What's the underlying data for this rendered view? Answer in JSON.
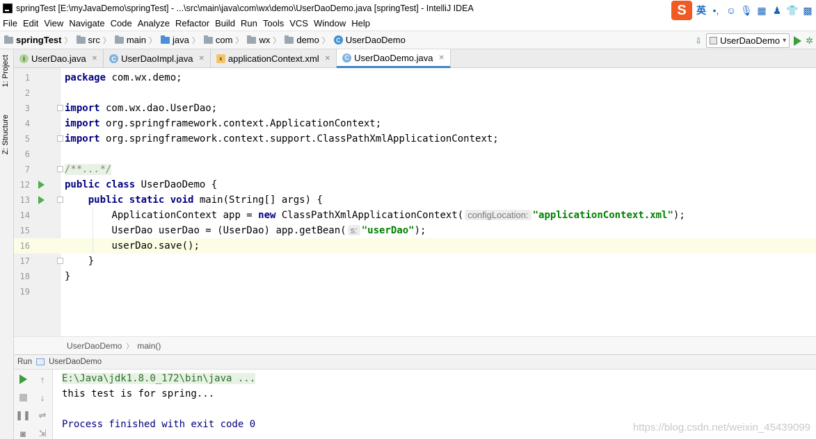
{
  "window": {
    "title": "springTest [E:\\myJavaDemo\\springTest] - ...\\src\\main\\java\\com\\wx\\demo\\UserDaoDemo.java [springTest] - IntelliJ IDEA"
  },
  "ime": {
    "logo": "S",
    "mode": "英"
  },
  "menu": [
    "File",
    "Edit",
    "View",
    "Navigate",
    "Code",
    "Analyze",
    "Refactor",
    "Build",
    "Run",
    "Tools",
    "VCS",
    "Window",
    "Help"
  ],
  "breadcrumbs": {
    "project": "springTest",
    "src": "src",
    "main": "main",
    "java": "java",
    "com": "com",
    "wx": "wx",
    "demo": "demo",
    "file": "UserDaoDemo"
  },
  "run_config": {
    "label": "UserDaoDemo"
  },
  "tool_windows": {
    "project": "1: Project",
    "structure": "Z: Structure"
  },
  "tabs": [
    {
      "label": "UserDao.java",
      "icon": "interface-icon",
      "icon_letter": "I"
    },
    {
      "label": "UserDaoImpl.java",
      "icon": "class-icon",
      "icon_letter": "C"
    },
    {
      "label": "applicationContext.xml",
      "icon": "xml-file-icon",
      "icon_letter": "x"
    },
    {
      "label": "UserDaoDemo.java",
      "icon": "class-icon",
      "icon_letter": "C",
      "active": true
    }
  ],
  "code": {
    "line_numbers": [
      "1",
      "2",
      "3",
      "4",
      "5",
      "6",
      "7",
      "12",
      "13",
      "14",
      "15",
      "16",
      "17",
      "18",
      "19"
    ],
    "l1": {
      "kw": "package",
      "rest": " com.wx.demo;"
    },
    "l3": {
      "kw": "import",
      "rest": " com.wx.dao.UserDao;"
    },
    "l4": {
      "kw": "import",
      "rest": " org.springframework.context.ApplicationContext;"
    },
    "l5": {
      "kw": "import",
      "rest": " org.springframework.context.support.ClassPathXmlApplicationContext;"
    },
    "l7": {
      "comment": "/**...*/"
    },
    "l12": {
      "kw": "public class",
      "rest": " UserDaoDemo {"
    },
    "l13": {
      "kw": "public static void",
      "rest": " main(String[] args) {"
    },
    "l14": {
      "pre": "ApplicationContext app = ",
      "kw": "new",
      "mid": " ClassPathXmlApplicationContext(",
      "hint": "configLocation:",
      "str": "\"applicationContext.xml\"",
      "post": ");"
    },
    "l15": {
      "pre": "UserDao userDao = (UserDao) app.getBean(",
      "hint": "s:",
      "str": "\"userDao\"",
      "post": ");"
    },
    "l16": {
      "text": "userDao.save();"
    },
    "l17": {
      "text": "}"
    },
    "l18": {
      "text": "}"
    }
  },
  "editor_breadcrumb": {
    "class": "UserDaoDemo",
    "method": "main()"
  },
  "run_panel": {
    "label": "Run",
    "config": "UserDaoDemo"
  },
  "console": {
    "cmd": "E:\\Java\\jdk1.8.0_172\\bin\\java ...",
    "output": "this test is for spring...",
    "exit": "Process finished with exit code 0"
  },
  "watermark": "https://blog.csdn.net/weixin_45439099",
  "colors": {
    "keyword": "#000080",
    "string": "#008000",
    "accent": "#4083c9",
    "run": "#3c9d3c"
  }
}
